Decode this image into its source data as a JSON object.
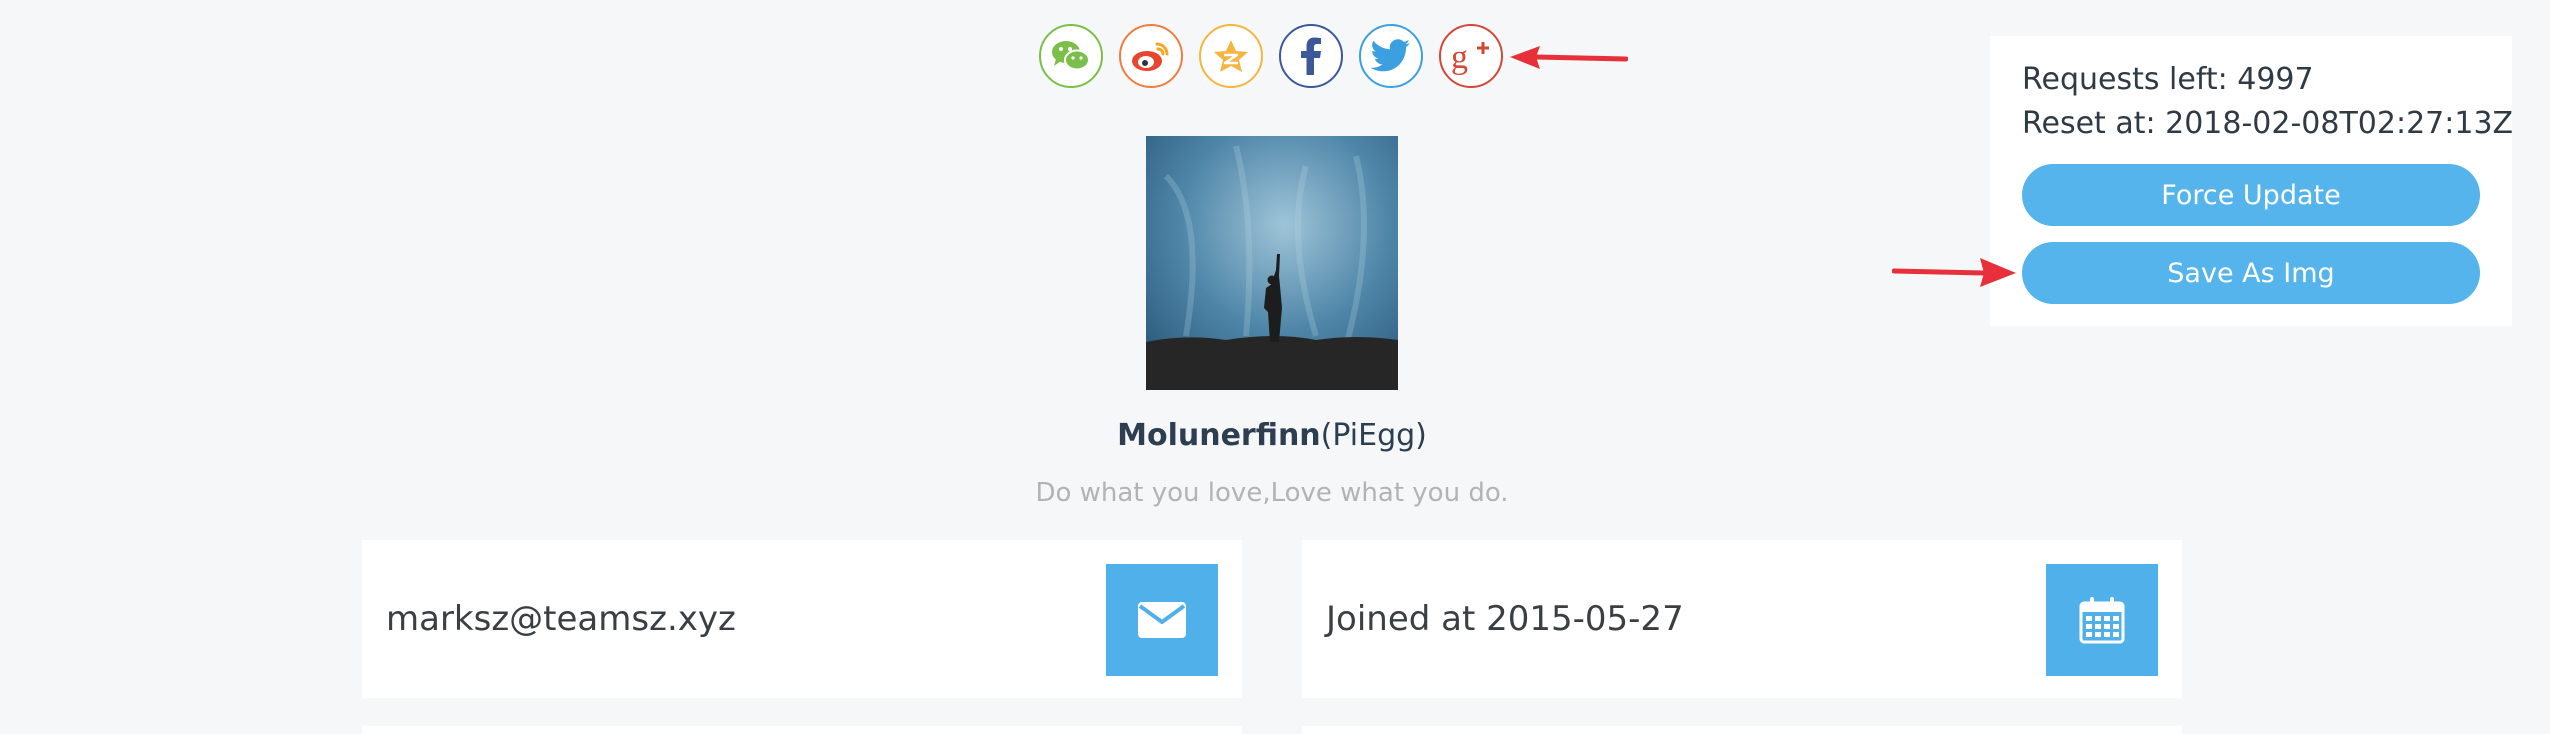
{
  "share": {
    "buttons": [
      {
        "name": "wechat-share-button",
        "icon": "wechat-icon",
        "color": "#7bbf4a"
      },
      {
        "name": "weibo-share-button",
        "icon": "weibo-icon",
        "color": "#ee7d3f"
      },
      {
        "name": "qzone-share-button",
        "icon": "qzone-star-icon",
        "color": "#f5b540"
      },
      {
        "name": "facebook-share-button",
        "icon": "facebook-icon",
        "color": "#3b5998"
      },
      {
        "name": "twitter-share-button",
        "icon": "twitter-icon",
        "color": "#3b9fe0"
      },
      {
        "name": "google-plus-share-button",
        "icon": "google-plus-icon",
        "color": "#d34836"
      }
    ]
  },
  "profile": {
    "username": "Molunerfinn",
    "nickname": "(PiEgg)",
    "tagline": "Do what you love,Love what you do."
  },
  "cards": {
    "email": {
      "text": "marksz@teamsz.xyz",
      "icon": "envelope-icon"
    },
    "joined": {
      "text": "Joined at 2015-05-27",
      "icon": "calendar-icon"
    }
  },
  "rate_panel": {
    "requests_left": "Requests left: 4997",
    "reset_at": "Reset at: 2018-02-08T02:27:13Z",
    "force_update_label": "Force Update",
    "save_as_img_label": "Save As Img"
  },
  "colors": {
    "accent": "#55b4ec",
    "icon_tile": "#4fb0ea",
    "arrow": "#e8303a",
    "background": "#f6f7f9"
  }
}
